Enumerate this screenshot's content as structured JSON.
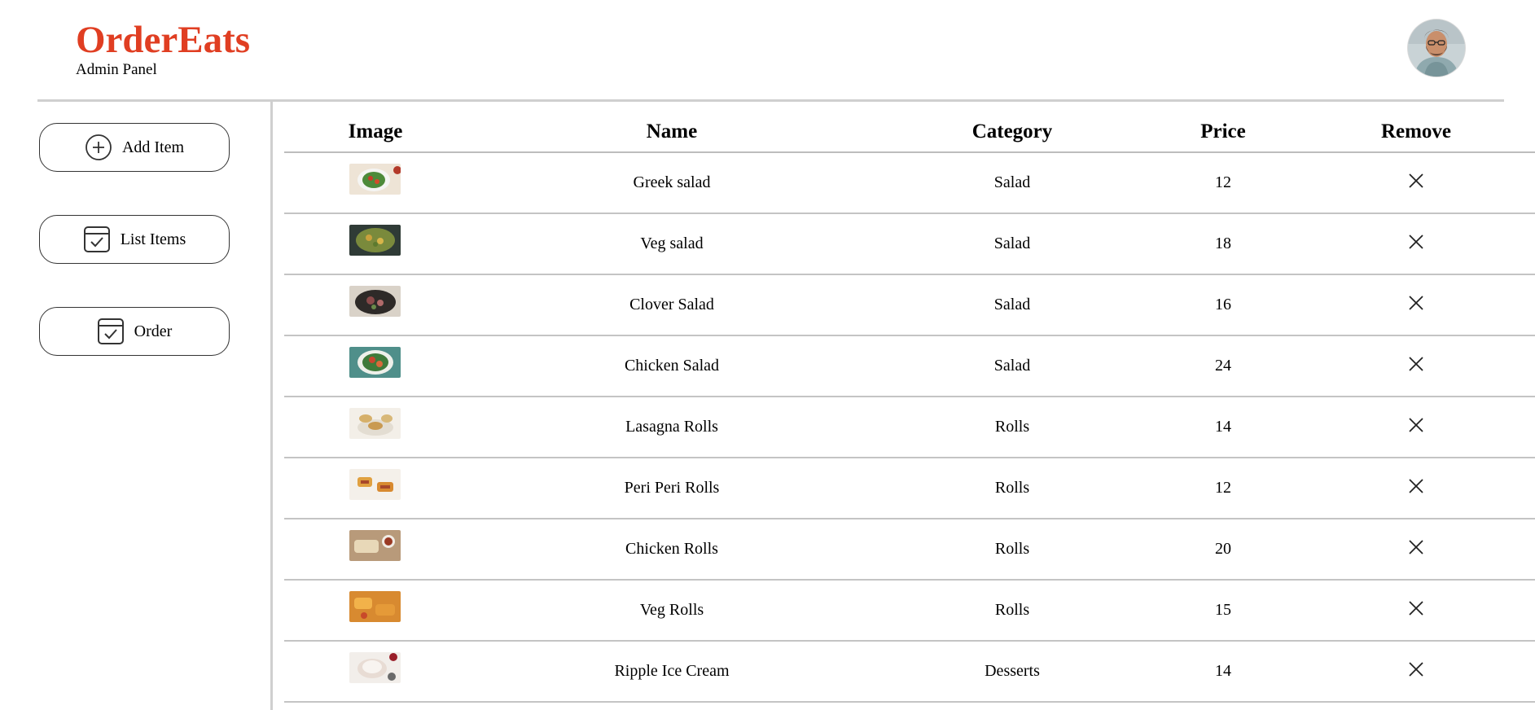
{
  "header": {
    "brand": "OrderEats",
    "subtitle": "Admin Panel",
    "avatar_icon": "user-avatar"
  },
  "colors": {
    "brand": "#e03e22",
    "divider": "#cfcfcf",
    "border": "#333333"
  },
  "sidebar": {
    "items": [
      {
        "label": "Add Item",
        "icon": "plus-circle-icon"
      },
      {
        "label": "List Items",
        "icon": "checklist-icon"
      },
      {
        "label": "Order",
        "icon": "checklist-icon"
      }
    ]
  },
  "table": {
    "headers": [
      "Image",
      "Name",
      "Category",
      "Price",
      "Remove"
    ],
    "rows": [
      {
        "name": "Greek salad",
        "category": "Salad",
        "price": "12"
      },
      {
        "name": "Veg salad",
        "category": "Salad",
        "price": "18"
      },
      {
        "name": "Clover Salad",
        "category": "Salad",
        "price": "16"
      },
      {
        "name": "Chicken Salad",
        "category": "Salad",
        "price": "24"
      },
      {
        "name": "Lasagna Rolls",
        "category": "Rolls",
        "price": "14"
      },
      {
        "name": "Peri Peri Rolls",
        "category": "Rolls",
        "price": "12"
      },
      {
        "name": "Chicken Rolls",
        "category": "Rolls",
        "price": "20"
      },
      {
        "name": "Veg Rolls",
        "category": "Rolls",
        "price": "15"
      },
      {
        "name": "Ripple Ice Cream",
        "category": "Desserts",
        "price": "14"
      }
    ]
  }
}
